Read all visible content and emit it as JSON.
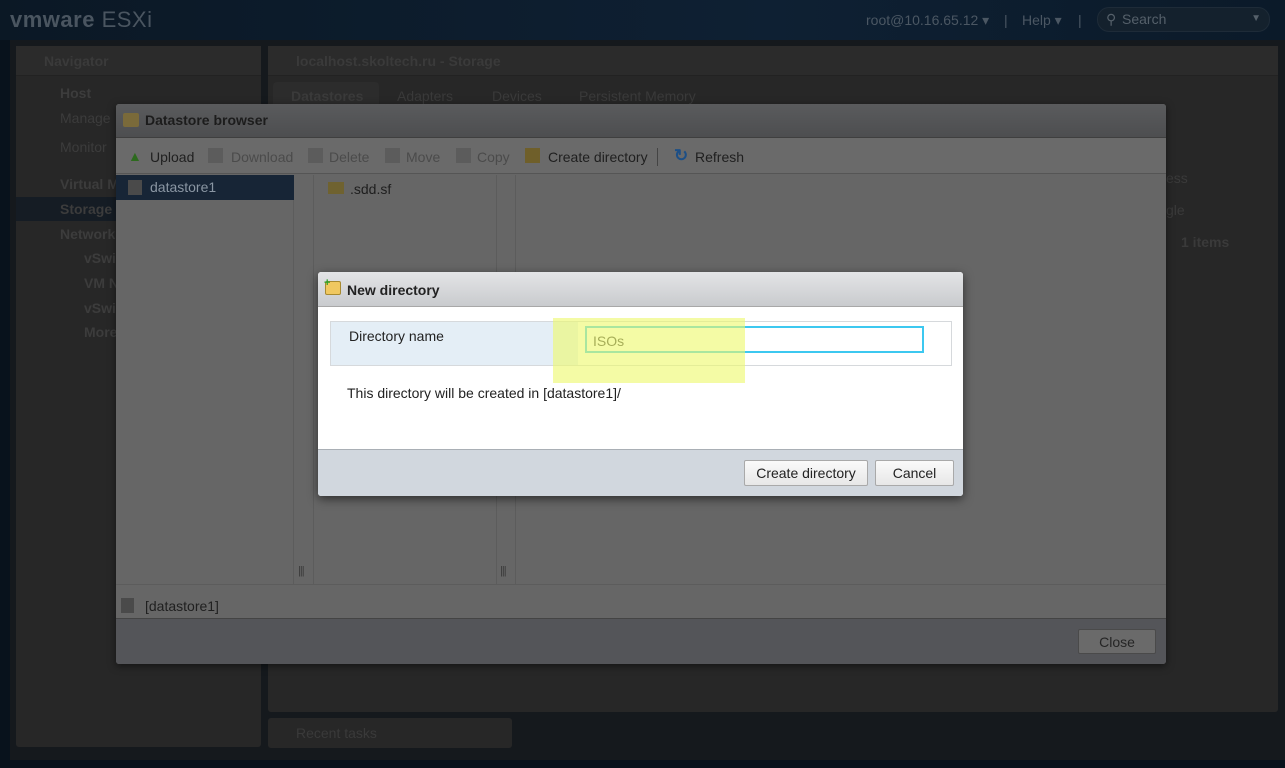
{
  "header": {
    "brand": "vmware",
    "product": "ESXi",
    "user": "root@10.16.65.12",
    "help": "Help",
    "search_placeholder": "Search"
  },
  "navigator": {
    "title": "Navigator",
    "items": [
      {
        "label": "Host",
        "level": 0,
        "icon": "host-icon"
      },
      {
        "label": "Manage",
        "level": 1
      },
      {
        "label": "Monitor",
        "level": 1
      },
      {
        "label": "Virtual M",
        "level": 0,
        "icon": "vm-icon"
      },
      {
        "label": "Storage",
        "level": 0,
        "icon": "storage-icon",
        "selected": true
      },
      {
        "label": "Networki",
        "level": 0,
        "icon": "network-icon"
      },
      {
        "label": "vSwi",
        "level": 1,
        "icon": "switch-icon"
      },
      {
        "label": "VM N",
        "level": 1,
        "icon": "network-icon"
      },
      {
        "label": "vSwi",
        "level": 1,
        "icon": "switch-icon"
      },
      {
        "label": "More",
        "level": 1
      }
    ]
  },
  "main": {
    "title": "localhost.skoltech.ru - Storage",
    "tabs": [
      "Datastores",
      "Adapters",
      "Devices",
      "Persistent Memory"
    ],
    "active_tab": "Datastores",
    "partial": {
      "col_header": "ess",
      "cell": "gle",
      "count": "1 items"
    }
  },
  "recent_tasks": "Recent tasks",
  "datastore_browser": {
    "title": "Datastore browser",
    "toolbar": [
      {
        "label": "Upload",
        "icon": "upload-icon",
        "enabled": true
      },
      {
        "label": "Download",
        "icon": "download-icon",
        "enabled": false
      },
      {
        "label": "Delete",
        "icon": "delete-icon",
        "enabled": false
      },
      {
        "label": "Move",
        "icon": "move-icon",
        "enabled": false
      },
      {
        "label": "Copy",
        "icon": "copy-icon",
        "enabled": false
      },
      {
        "label": "Create directory",
        "icon": "folder-add-icon",
        "enabled": true
      },
      {
        "label": "Refresh",
        "icon": "refresh-icon",
        "enabled": true
      }
    ],
    "datastores": [
      "datastore1"
    ],
    "files": [
      ".sdd.sf"
    ],
    "path": "[datastore1]",
    "close": "Close"
  },
  "new_directory": {
    "title": "New directory",
    "field_label": "Directory name",
    "field_value": "ISOs",
    "note": "This directory will be created in [datastore1]/",
    "create": "Create directory",
    "cancel": "Cancel"
  },
  "colors": {
    "input_focus": "#3cc8f0",
    "highlight": "#eef86e",
    "selected_row": "#172536"
  }
}
